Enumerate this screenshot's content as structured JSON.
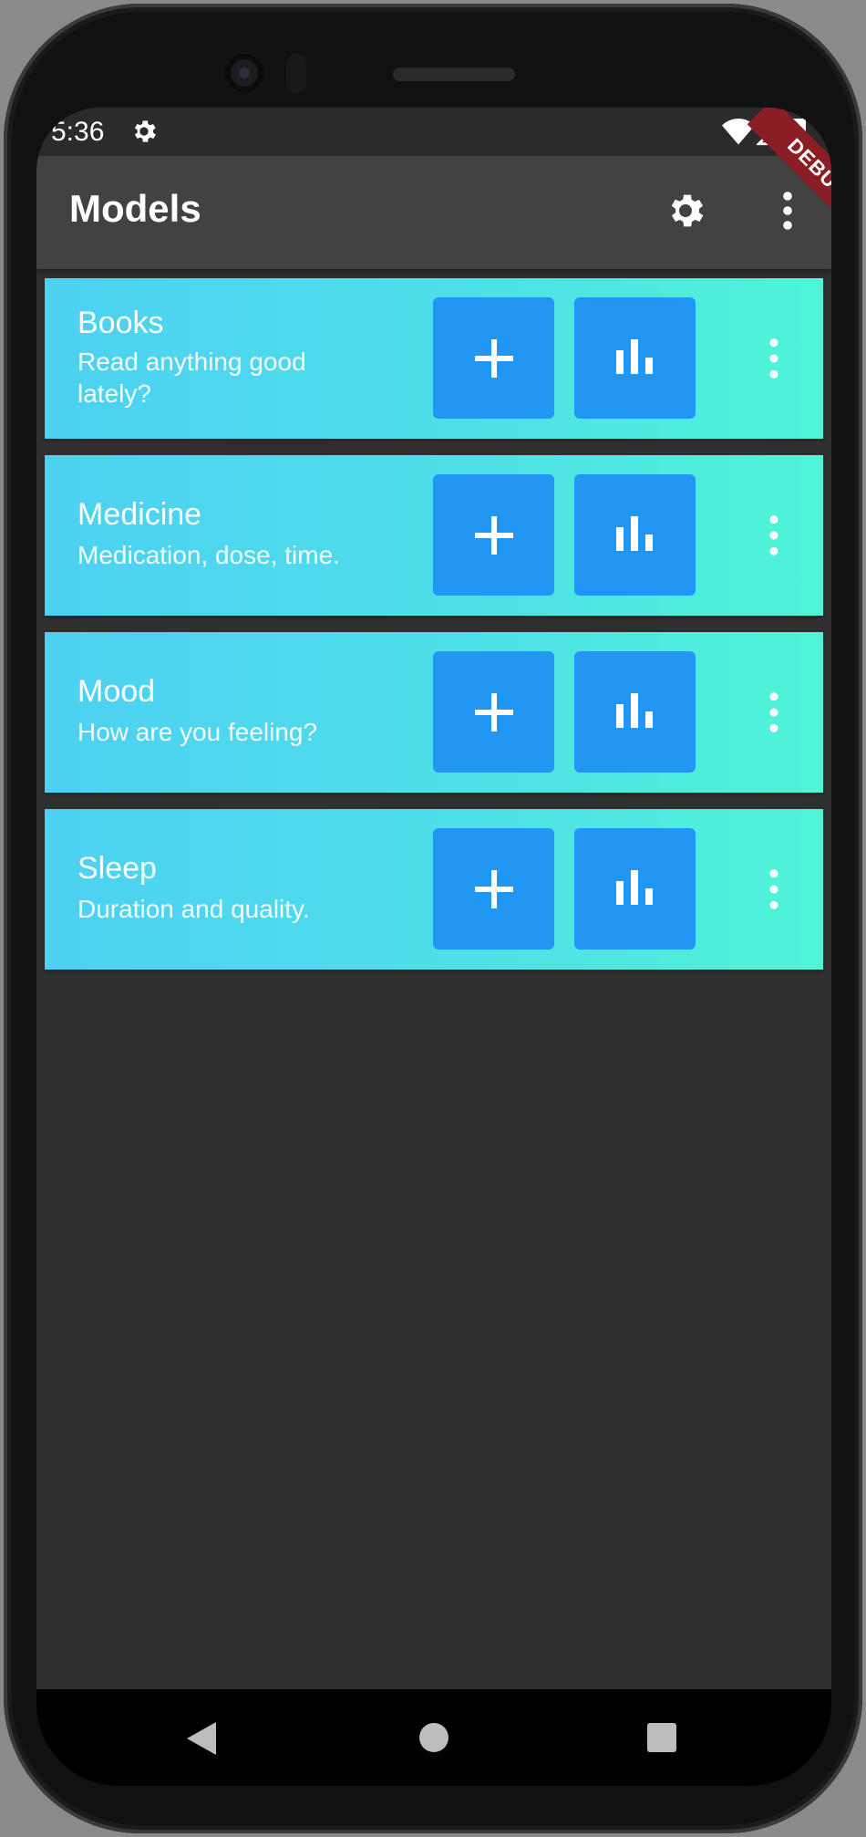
{
  "status": {
    "time": "5:36"
  },
  "appbar": {
    "title": "Models"
  },
  "debug_label": "DEBUG",
  "models": [
    {
      "name": "Books",
      "description": "Read anything good lately?"
    },
    {
      "name": "Medicine",
      "description": "Medication, dose, time."
    },
    {
      "name": "Mood",
      "description": "How are you feeling?"
    },
    {
      "name": "Sleep",
      "description": "Duration and quality."
    }
  ],
  "icons": {
    "status_settings": "gear-icon",
    "wifi": "wifi-icon",
    "signal": "signal-icon",
    "battery": "battery-icon",
    "appbar_settings": "settings-icon",
    "overflow": "more-vert-icon",
    "add": "plus-icon",
    "stats": "bar-chart-icon",
    "card_menu": "more-vert-icon",
    "nav_back": "back-triangle-icon",
    "nav_home": "home-circle-icon",
    "nav_recents": "recents-square-icon"
  },
  "colors": {
    "background": "#303030",
    "appbar": "#424242",
    "card_gradient_start": "#4dd0f2",
    "card_gradient_end": "#4ff4d6",
    "button": "#2196f3",
    "debug_banner": "#8b1e24"
  }
}
